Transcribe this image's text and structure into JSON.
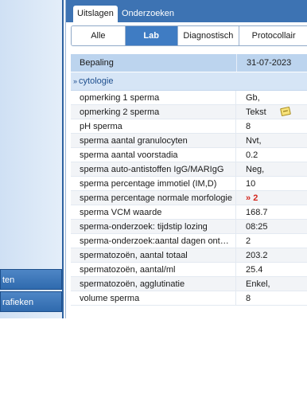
{
  "sidebar": {
    "buttons": [
      {
        "label": "ten"
      },
      {
        "label": "rafieken"
      }
    ]
  },
  "tabs": {
    "active": "Uitslagen",
    "inactive": "Onderzoeken"
  },
  "segments": [
    {
      "label": "Alle",
      "active": false
    },
    {
      "label": "Lab",
      "active": true
    },
    {
      "label": "Diagnostisch",
      "active": false
    },
    {
      "label": "Protocollair",
      "active": false
    }
  ],
  "table": {
    "header": {
      "bepaling": "Bepaling",
      "date": "31-07-2023"
    },
    "group": {
      "chevron": "»",
      "label": "cytologie"
    },
    "rows": [
      {
        "name": "opmerking 1 sperma",
        "value": "Gb,"
      },
      {
        "name": "opmerking 2 sperma",
        "value": "Tekst"
      },
      {
        "name": "pH sperma",
        "value": "8"
      },
      {
        "name": "sperma aantal granulocyten",
        "value": "Nvt,"
      },
      {
        "name": "sperma aantal voorstadia",
        "value": "0.2"
      },
      {
        "name": "sperma auto-antistoffen IgG/MARIgG",
        "value": "Neg,"
      },
      {
        "name": "sperma percentage immotiel (IM,D)",
        "value": "10"
      },
      {
        "name": "sperma percentage normale morfologie",
        "value": "2",
        "flag": "»"
      },
      {
        "name": "sperma VCM waarde",
        "value": "168.7"
      },
      {
        "name": "sperma-onderzoek: tijdstip lozing",
        "value": "08:25"
      },
      {
        "name": "sperma-onderzoek:aantal dagen ont…",
        "value": "2"
      },
      {
        "name": "spermatozoën, aantal totaal",
        "value": "203.2"
      },
      {
        "name": "spermatozoën, aantal/ml",
        "value": "25.4"
      },
      {
        "name": "spermatozoën, agglutinatie",
        "value": "Enkel,"
      },
      {
        "name": "volume sperma",
        "value": "8"
      }
    ]
  },
  "colors": {
    "accent": "#3d73b3",
    "header_bg": "#bcd4ee",
    "flag": "#d4281f"
  },
  "icons": {
    "note": "note-icon",
    "flag": "low-flag-icon"
  }
}
